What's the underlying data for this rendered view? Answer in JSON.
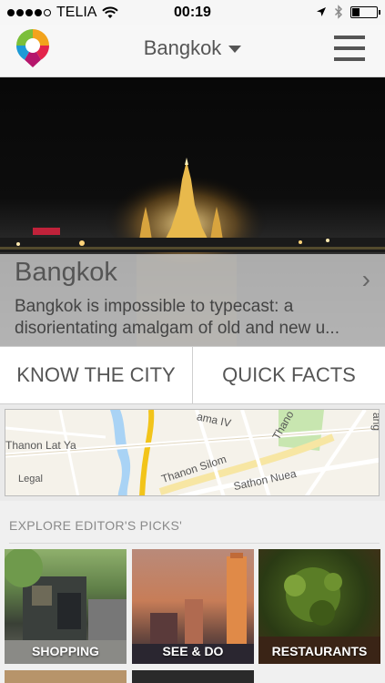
{
  "status_bar": {
    "carrier": "TELIA",
    "time": "00:19",
    "battery_level": 0.3
  },
  "header": {
    "city": "Bangkok",
    "logo_icon": "map-pin-logo-icon",
    "menu_icon": "hamburger-menu-icon"
  },
  "hero": {
    "title": "Bangkok",
    "description": "Bangkok is impossible to typecast: a disorientating amalgam of old and new u...",
    "chevron": "›"
  },
  "actions": {
    "know_city": "KNOW THE CITY",
    "quick_facts": "QUICK FACTS"
  },
  "map": {
    "labels": {
      "road_1": "Thanon Lat Ya",
      "road_2": "Thanon Silom",
      "road_3": "Sathon Nuea",
      "road_4": "ama IV",
      "road_5": "Thano",
      "road_6": "ang"
    },
    "legal": "Legal"
  },
  "picks": {
    "title": "EXPLORE EDITOR'S PICKS'",
    "items": [
      {
        "label": "SHOPPING"
      },
      {
        "label": "SEE & DO"
      },
      {
        "label": "RESTAURANTS"
      }
    ]
  },
  "colors": {
    "header_bg": "#f7f7f7",
    "text_gray": "#555555",
    "picks_bg": "#f0f0f0"
  }
}
